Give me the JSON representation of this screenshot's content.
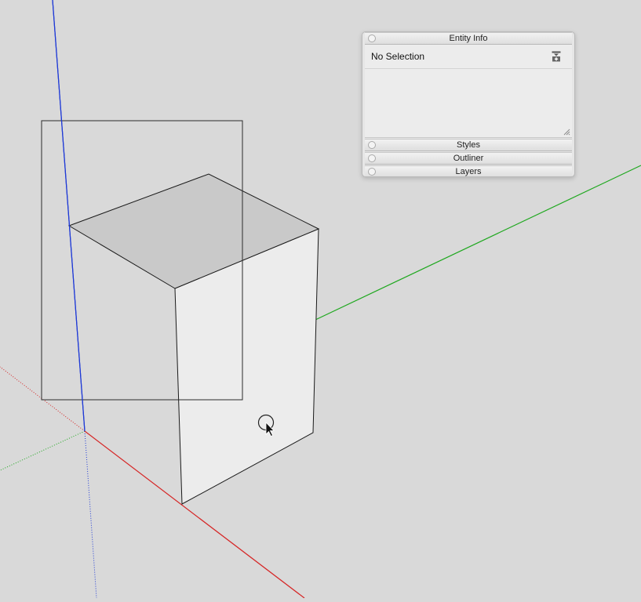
{
  "scene": {
    "colors": {
      "background": "#d9d9d9",
      "axis_red": "#d62626",
      "axis_green": "#1fa81f",
      "axis_blue": "#1f3ad6",
      "edge": "#1a1a1a",
      "top_face": "#c9c9c9",
      "front_face": "#ececec"
    },
    "cursor": "select-arrow-icon"
  },
  "tray": {
    "entity_info": {
      "title": "Entity Info",
      "selection_text": "No Selection",
      "toggle_icon": "expand-details-icon"
    },
    "panels": [
      {
        "title": "Styles"
      },
      {
        "title": "Outliner"
      },
      {
        "title": "Layers"
      }
    ]
  }
}
